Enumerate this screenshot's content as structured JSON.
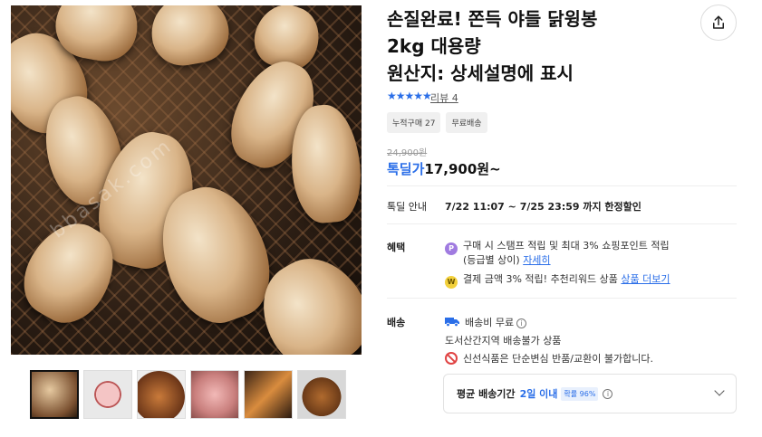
{
  "product": {
    "title_lines": [
      "손질완료! 쫀득 야들 닭윙봉",
      "2kg 대용량",
      "원산지: 상세설명에 표시"
    ],
    "rating_stars": "★★★★★",
    "review_link": "리뷰 4",
    "chips": [
      "누적구매 27",
      "무료배송"
    ],
    "original_price": "24,900원",
    "deal_label": "톡딜가",
    "deal_price": "17,900원~",
    "watermark": "bbasak.com"
  },
  "deal_info": {
    "label": "톡딜 안내",
    "value": "7/22 11:07 ~ 7/25 23:59 까지 한정할인"
  },
  "benefits": {
    "label": "혜택",
    "line1": "구매 시 스탬프 적립 및 최대 3% 쇼핑포인트 적립",
    "line1b": "(등급별 상이)",
    "line1_link": "자세히",
    "line2": "결제 금액 3% 적립! 추천리워드 상품",
    "line2_link": "상품 더보기",
    "icon1": "P",
    "icon2": "W"
  },
  "shipping": {
    "label": "배송",
    "fee": "배송비 무료",
    "region": "도서산간지역 배송불가 상품",
    "notice": "신선식품은 단순변심 반품/교환이 불가합니다."
  },
  "delivery": {
    "label": "평균 배송기간",
    "value": "2일 이내",
    "badge": "확률 96%"
  },
  "colors": {
    "accent": "#2a6ee8",
    "warning": "#e04444"
  },
  "icons": [
    "share-icon",
    "star-icon",
    "point-icon",
    "reward-icon",
    "truck-icon",
    "info-icon",
    "no-icon",
    "chevron-down-icon"
  ]
}
